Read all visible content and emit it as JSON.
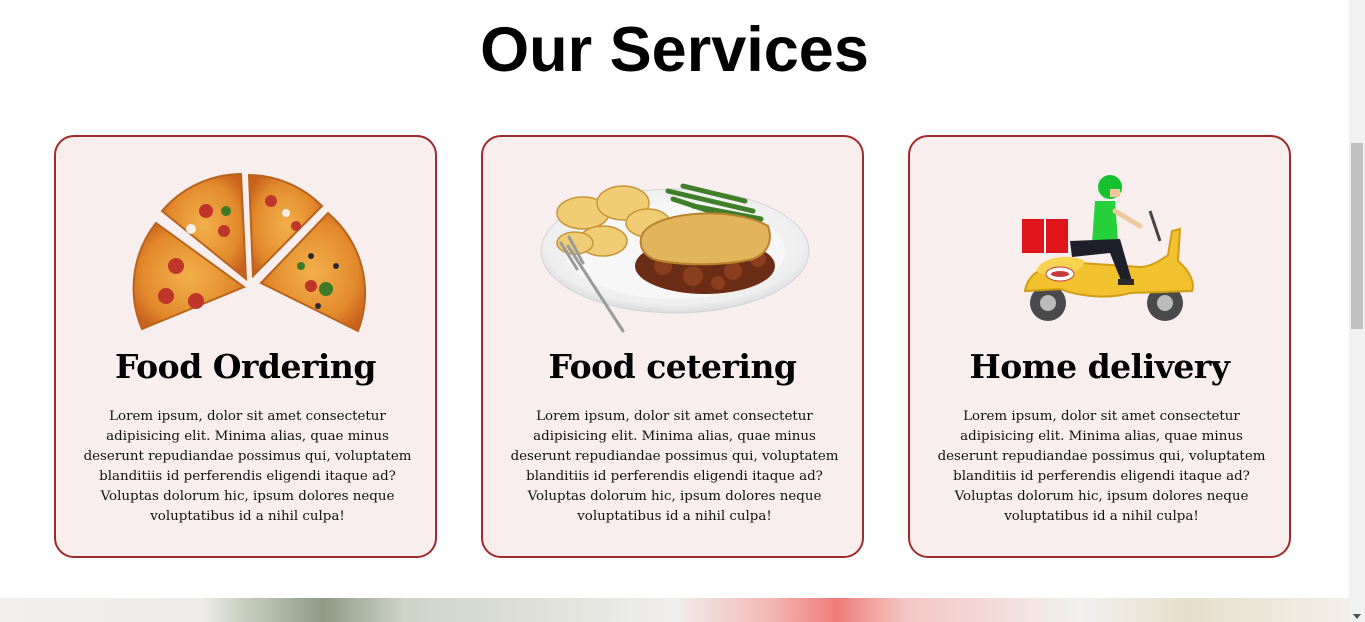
{
  "section": {
    "title": "Our Services"
  },
  "cards": [
    {
      "title": "Food Ordering",
      "description": "Lorem ipsum, dolor sit amet consectetur adipisicing elit. Minima alias, quae minus deserunt repudiandae possimus qui, voluptatem blanditiis id perferendis eligendi itaque ad? Voluptas dolorum hic, ipsum dolores neque voluptatibus id a nihil culpa!",
      "image": "pizza-slices-image"
    },
    {
      "title": "Food cetering",
      "description": "Lorem ipsum, dolor sit amet consectetur adipisicing elit. Minima alias, quae minus deserunt repudiandae possimus qui, voluptatem blanditiis id perferendis eligendi itaque ad? Voluptas dolorum hic, ipsum dolores neque voluptatibus id a nihil culpa!",
      "image": "plated-meal-image"
    },
    {
      "title": "Home delivery",
      "description": "Lorem ipsum, dolor sit amet consectetur adipisicing elit. Minima alias, quae minus deserunt repudiandae possimus qui, voluptatem blanditiis id perferendis eligendi itaque ad? Voluptas dolorum hic, ipsum dolores neque voluptatibus id a nihil culpa!",
      "image": "delivery-scooter-image"
    }
  ],
  "colors": {
    "card_border": "#a12b2b",
    "card_background": "#f8eeee"
  }
}
